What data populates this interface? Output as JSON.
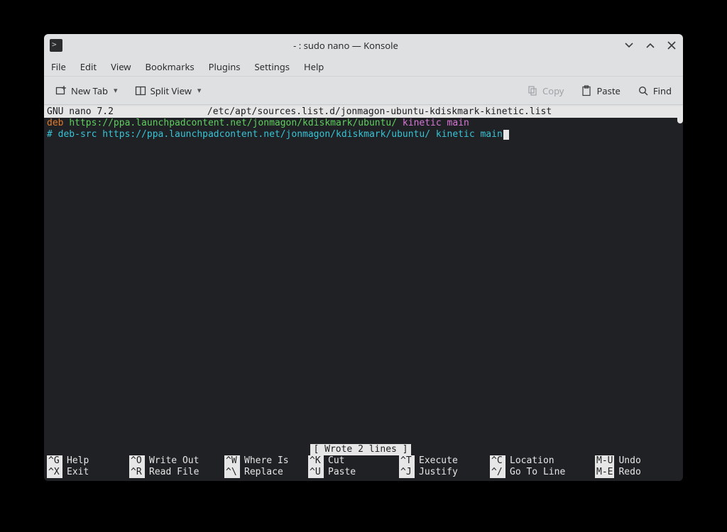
{
  "window": {
    "title": "- : sudo nano — Konsole"
  },
  "menubar": [
    "File",
    "Edit",
    "View",
    "Bookmarks",
    "Plugins",
    "Settings",
    "Help"
  ],
  "toolbar": {
    "new_tab": "New Tab",
    "split": "Split View",
    "copy": "Copy",
    "paste": "Paste",
    "find": "Find"
  },
  "nano": {
    "version": "GNU nano 7.2",
    "filename": "/etc/apt/sources.list.d/jonmagon-ubuntu-kdiskmark-kinetic.list",
    "lines": {
      "l1_deb": "deb",
      "l1_url": "https://ppa.launchpadcontent.net/jonmagon/kdiskmark/ubuntu/",
      "l1_dist": "kinetic main",
      "l2_full": "# deb-src https://ppa.launchpadcontent.net/jonmagon/kdiskmark/ubuntu/ kinetic main"
    },
    "status": "[ Wrote 2 lines ]",
    "shortcuts": [
      [
        {
          "key": "^G",
          "desc": "Help"
        },
        {
          "key": "^O",
          "desc": "Write Out"
        },
        {
          "key": "^W",
          "desc": "Where Is"
        },
        {
          "key": "^K",
          "desc": "Cut"
        },
        {
          "key": "^T",
          "desc": "Execute"
        },
        {
          "key": "^C",
          "desc": "Location"
        },
        {
          "key": "M-U",
          "desc": "Undo"
        }
      ],
      [
        {
          "key": "^X",
          "desc": "Exit"
        },
        {
          "key": "^R",
          "desc": "Read File"
        },
        {
          "key": "^\\",
          "desc": "Replace"
        },
        {
          "key": "^U",
          "desc": "Paste"
        },
        {
          "key": "^J",
          "desc": "Justify"
        },
        {
          "key": "^/",
          "desc": "Go To Line"
        },
        {
          "key": "M-E",
          "desc": "Redo"
        }
      ]
    ]
  }
}
